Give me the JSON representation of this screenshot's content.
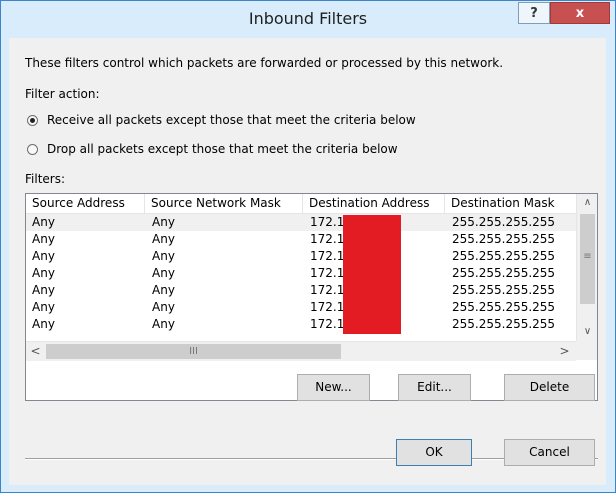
{
  "window": {
    "title": "Inbound Filters",
    "help_label": "?",
    "close_label": "x"
  },
  "description": "These filters control which packets are forwarded or processed by this network.",
  "filter_action": {
    "label": "Filter action:",
    "options": [
      {
        "label": "Receive all packets except those that meet the criteria below",
        "selected": true
      },
      {
        "label": "Drop all packets except those that meet the criteria below",
        "selected": false
      }
    ]
  },
  "filters": {
    "label": "Filters:",
    "columns": [
      "Source Address",
      "Source Network Mask",
      "Destination Address",
      "Destination Mask"
    ],
    "rows": [
      [
        "Any",
        "Any",
        "172.1",
        "255.255.255.255"
      ],
      [
        "Any",
        "Any",
        "172.1",
        "255.255.255.255"
      ],
      [
        "Any",
        "Any",
        "172.1",
        "255.255.255.255"
      ],
      [
        "Any",
        "Any",
        "172.1",
        "255.255.255.255"
      ],
      [
        "Any",
        "Any",
        "172.1",
        "255.255.255.255"
      ],
      [
        "Any",
        "Any",
        "172.1",
        "255.255.255.255"
      ],
      [
        "Any",
        "Any",
        "172.1",
        "255.255.255.255"
      ]
    ],
    "selected_row": 0,
    "scroll": {
      "up": "∧",
      "down": "∨",
      "left": "<",
      "right": ">",
      "v_grip": "≡",
      "h_grip": "III"
    },
    "redaction_color": "#e31b23"
  },
  "buttons": {
    "new": "New...",
    "edit": "Edit...",
    "delete": "Delete",
    "ok": "OK",
    "cancel": "Cancel"
  },
  "colors": {
    "title_bar": "#d9ecfb",
    "close_button": "#c75050",
    "border": "#3a86c8"
  }
}
